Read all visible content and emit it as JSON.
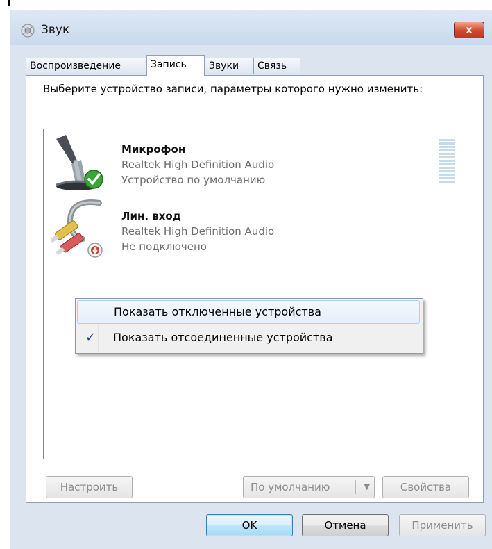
{
  "window": {
    "title": "Звук",
    "close_glyph": "x"
  },
  "tabs": [
    {
      "label": "Воспроизведение",
      "active": false
    },
    {
      "label": "Запись",
      "active": true
    },
    {
      "label": "Звуки",
      "active": false
    },
    {
      "label": "Связь",
      "active": false
    }
  ],
  "panel": {
    "instruction": "Выберите устройство записи, параметры которого нужно изменить:"
  },
  "devices": [
    {
      "name": "Микрофон",
      "driver": "Realtek High Definition Audio",
      "status": "Устройство по умолчанию",
      "icon": "microphone-icon",
      "badge": "default-check-badge"
    },
    {
      "name": "Лин. вход",
      "driver": "Realtek High Definition Audio",
      "status": "Не подключено",
      "icon": "line-in-cable-icon",
      "badge": "unplugged-badge"
    }
  ],
  "context_menu": {
    "items": [
      {
        "label": "Показать отключенные устройства",
        "checked": false
      },
      {
        "label": "Показать отсоединенные устройства",
        "checked": true
      }
    ],
    "check_glyph": "✓"
  },
  "buttons": {
    "configure": "Настроить",
    "set_default": "По умолчанию",
    "properties": "Свойства",
    "ok": "OK",
    "cancel": "Отмена",
    "apply": "Применить"
  },
  "colors": {
    "accent_check": "#1e3f8a",
    "close_red": "#c03a1f",
    "default_green": "#3aa63a"
  }
}
